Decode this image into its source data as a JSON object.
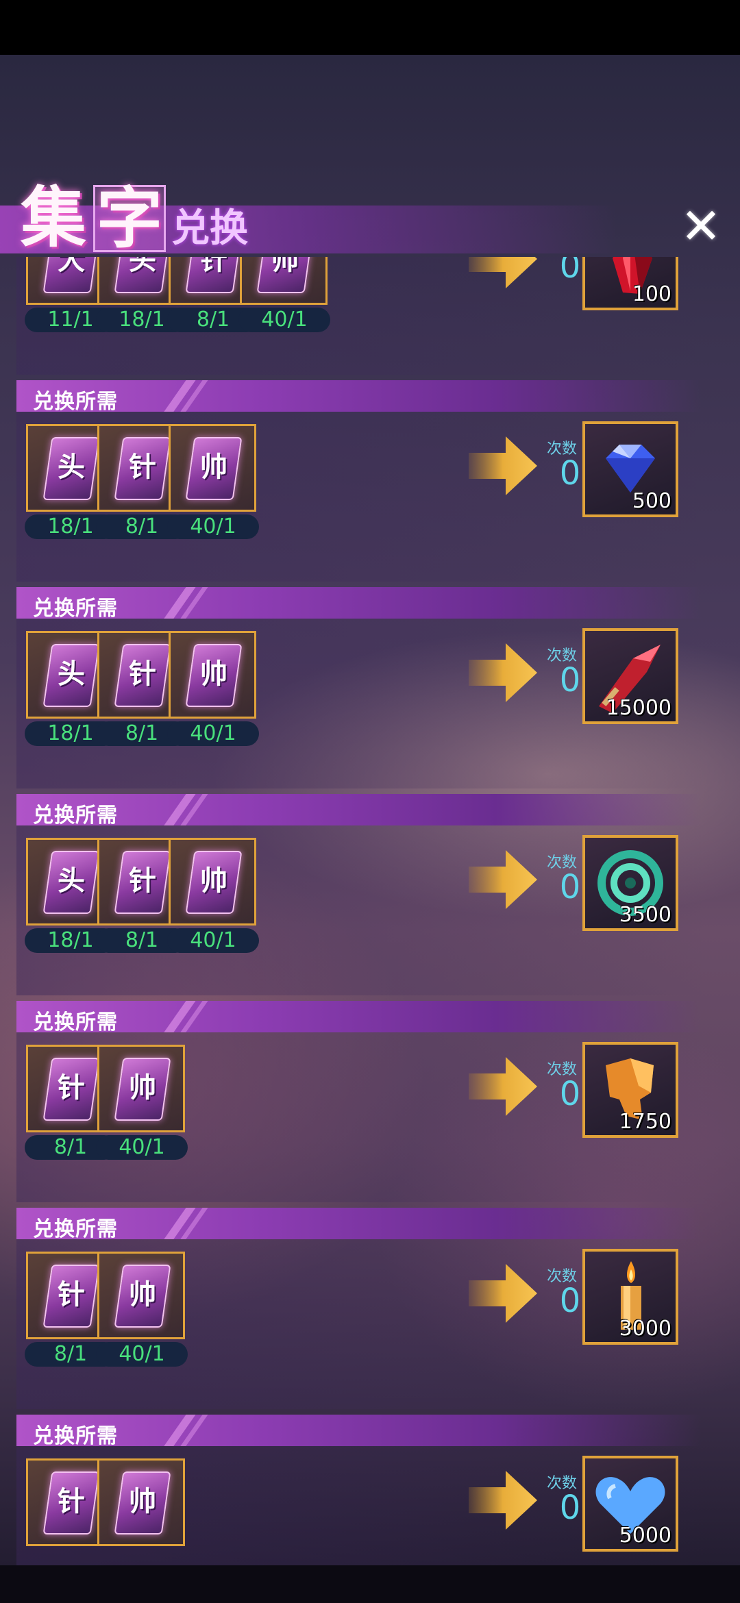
{
  "header": {
    "title_char1": "集",
    "title_char2": "字",
    "title_suffix": "兑换",
    "close_label": "✕"
  },
  "row_label": "兑换所需",
  "times_label": "次数",
  "rows": [
    {
      "cards": [
        {
          "char": "大",
          "count": "11/1"
        },
        {
          "char": "头",
          "count": "18/1"
        },
        {
          "char": "针",
          "count": "8/1"
        },
        {
          "char": "帅",
          "count": "40/1"
        }
      ],
      "times": "0",
      "reward": {
        "icon": "red-crystal-icon",
        "amount": "100"
      }
    },
    {
      "cards": [
        {
          "char": "头",
          "count": "18/1"
        },
        {
          "char": "针",
          "count": "8/1"
        },
        {
          "char": "帅",
          "count": "40/1"
        }
      ],
      "times": "0",
      "reward": {
        "icon": "blue-diamond-icon",
        "amount": "500"
      }
    },
    {
      "cards": [
        {
          "char": "头",
          "count": "18/1"
        },
        {
          "char": "针",
          "count": "8/1"
        },
        {
          "char": "帅",
          "count": "40/1"
        }
      ],
      "times": "0",
      "reward": {
        "icon": "red-blade-shard-icon",
        "amount": "15000"
      }
    },
    {
      "cards": [
        {
          "char": "头",
          "count": "18/1"
        },
        {
          "char": "针",
          "count": "8/1"
        },
        {
          "char": "帅",
          "count": "40/1"
        }
      ],
      "times": "0",
      "reward": {
        "icon": "green-spiral-icon",
        "amount": "3500"
      }
    },
    {
      "cards": [
        {
          "char": "针",
          "count": "8/1"
        },
        {
          "char": "帅",
          "count": "40/1"
        }
      ],
      "times": "0",
      "reward": {
        "icon": "golden-armor-shard-icon",
        "amount": "1750"
      }
    },
    {
      "cards": [
        {
          "char": "针",
          "count": "8/1"
        },
        {
          "char": "帅",
          "count": "40/1"
        }
      ],
      "times": "0",
      "reward": {
        "icon": "candle-icon",
        "amount": "3000"
      }
    },
    {
      "cards": [
        {
          "char": "针",
          "count": ""
        },
        {
          "char": "帅",
          "count": ""
        }
      ],
      "times": "0",
      "reward": {
        "icon": "blue-heart-icon",
        "amount": "5000"
      }
    }
  ],
  "colors": {
    "card_border": "#e0a23a",
    "count_text": "#49e07c",
    "times_text": "#5fd6ea",
    "label_band": "#8d3db3"
  }
}
